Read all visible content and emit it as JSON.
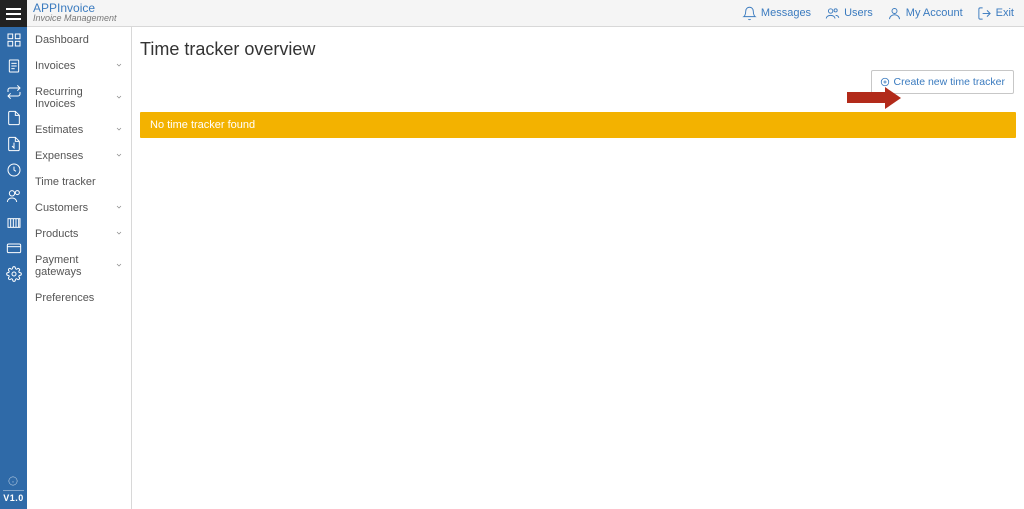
{
  "app": {
    "name": "APPInvoice",
    "tagline": "Invoice Management",
    "version": "V1.0"
  },
  "header_nav": {
    "messages": "Messages",
    "users": "Users",
    "account": "My Account",
    "exit": "Exit"
  },
  "sidebar": {
    "items": [
      {
        "label": "Dashboard",
        "expandable": false
      },
      {
        "label": "Invoices",
        "expandable": true
      },
      {
        "label": "Recurring Invoices",
        "expandable": true
      },
      {
        "label": "Estimates",
        "expandable": true
      },
      {
        "label": "Expenses",
        "expandable": true
      },
      {
        "label": "Time tracker",
        "expandable": false
      },
      {
        "label": "Customers",
        "expandable": true
      },
      {
        "label": "Products",
        "expandable": true
      },
      {
        "label": "Payment gateways",
        "expandable": true
      },
      {
        "label": "Preferences",
        "expandable": false
      }
    ]
  },
  "page": {
    "title": "Time tracker overview",
    "create_button": "Create new time tracker",
    "alert": "No time tracker found"
  }
}
